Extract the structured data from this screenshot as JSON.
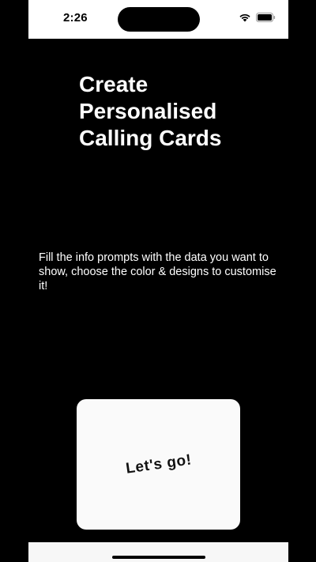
{
  "status_bar": {
    "time": "2:26",
    "icons": [
      "wifi-icon",
      "battery-icon"
    ]
  },
  "onboarding": {
    "headline": "Create\nPersonalised\nCalling Cards",
    "description": "Fill the info prompts with the data you want to show, choose the color & designs to customise it!",
    "cta_label": "Let's go!"
  },
  "colors": {
    "background": "#000000",
    "text": "#ffffff",
    "card": "#fafafa",
    "status_bar": "#ffffff"
  }
}
